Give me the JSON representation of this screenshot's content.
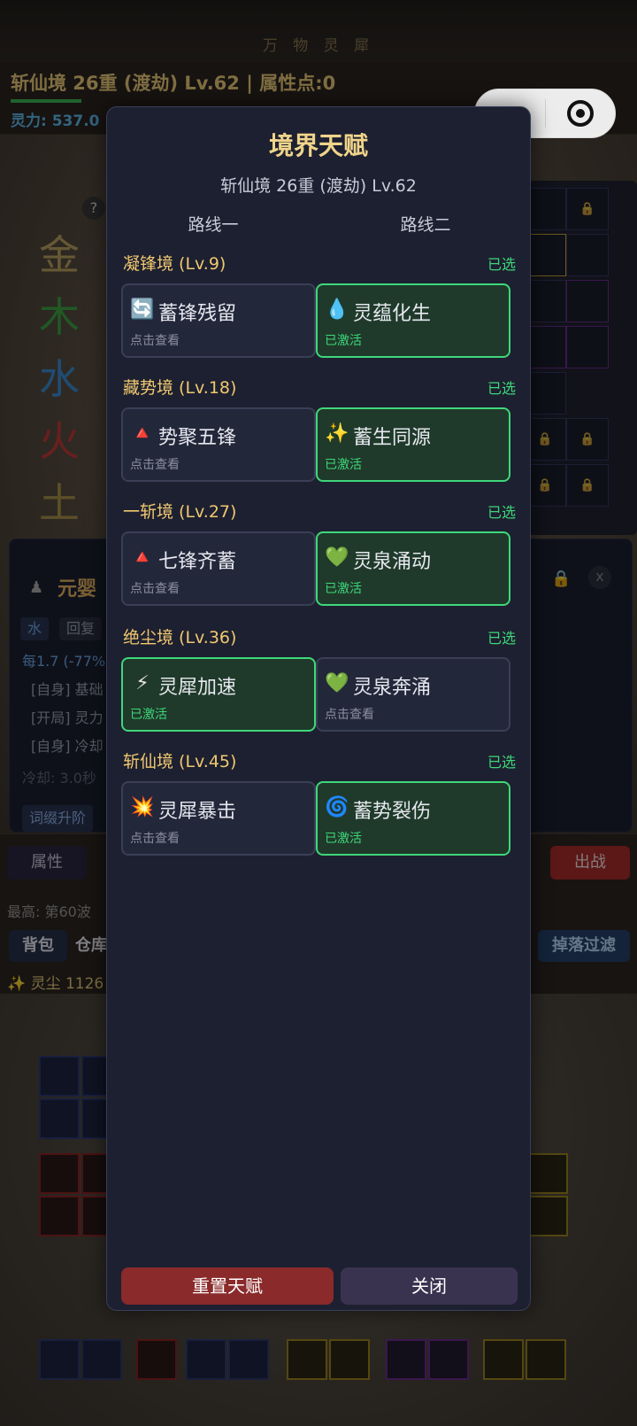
{
  "app": {
    "banner": "万 物 灵 犀",
    "realm_line": "斩仙境 26重 (渡劫) Lv.62 | 属性点:0",
    "mana_line": "灵力: 537.0"
  },
  "scene": {
    "elements": [
      {
        "char": "金",
        "color": "#b8a060"
      },
      {
        "char": "木",
        "color": "#3da043"
      },
      {
        "char": "水",
        "color": "#3a8ad0"
      },
      {
        "char": "火",
        "color": "#c03a3a"
      },
      {
        "char": "土",
        "color": "#a8904a"
      }
    ]
  },
  "skill_panel": {
    "title": "元婴",
    "chip_water": "水",
    "chip_recover": "回复",
    "line1": "每1.7 (-77%",
    "line2": "[自身] 基础",
    "line3": "[开局] 灵力",
    "line4": "[自身] 冷却",
    "line5": "冷却: 3.0秒",
    "upgrade_btn": "词缀升阶",
    "close_x": "x"
  },
  "bottom": {
    "tab_attr": "属性",
    "tab_battle": "出战",
    "best_wave": "最高: 第60波",
    "tab_bag": "背包",
    "tab_warehouse": "仓库",
    "tab_filter": "掉落过滤",
    "dust": "✨ 灵尘 1126"
  },
  "capsule": {
    "more_icon": "more-dots-icon",
    "close_icon": "target-circle-icon"
  },
  "modal": {
    "title": "境界天赋",
    "subtitle": "斩仙境 26重 (渡劫) Lv.62",
    "route1": "路线一",
    "route2": "路线二",
    "tiers": [
      {
        "name": "凝锋境 (Lv.9)",
        "selected": "已选",
        "left": {
          "icon": "🔄",
          "name": "蓄锋残留",
          "status": "点击查看",
          "active": false
        },
        "right": {
          "icon": "💧",
          "name": "灵蕴化生",
          "status": "已激活",
          "active": true
        }
      },
      {
        "name": "藏势境 (Lv.18)",
        "selected": "已选",
        "left": {
          "icon": "🔺",
          "name": "势聚五锋",
          "status": "点击查看",
          "active": false
        },
        "right": {
          "icon": "✨",
          "name": "蓄生同源",
          "status": "已激活",
          "active": true
        }
      },
      {
        "name": "一斩境 (Lv.27)",
        "selected": "已选",
        "left": {
          "icon": "🔺",
          "name": "七锋齐蓄",
          "status": "点击查看",
          "active": false
        },
        "right": {
          "icon": "💚",
          "name": "灵泉涌动",
          "status": "已激活",
          "active": true
        }
      },
      {
        "name": "绝尘境 (Lv.36)",
        "selected": "已选",
        "left": {
          "icon": "⚡",
          "name": "灵犀加速",
          "status": "已激活",
          "active": true
        },
        "right": {
          "icon": "💚",
          "name": "灵泉奔涌",
          "status": "点击查看",
          "active": false
        }
      },
      {
        "name": "斩仙境 (Lv.45)",
        "selected": "已选",
        "left": {
          "icon": "💥",
          "name": "灵犀暴击",
          "status": "点击查看",
          "active": false
        },
        "right": {
          "icon": "🌀",
          "name": "蓄势裂伤",
          "status": "已激活",
          "active": true
        }
      }
    ],
    "reset_label": "重置天赋",
    "close_label": "关闭"
  }
}
